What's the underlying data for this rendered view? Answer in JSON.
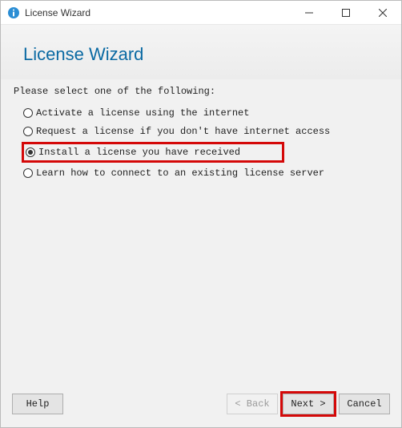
{
  "window": {
    "title": "License Wizard"
  },
  "header": {
    "title": "License Wizard"
  },
  "prompt": "Please select one of the following:",
  "options": [
    {
      "label": "Activate a license using the internet",
      "checked": false,
      "highlighted": false
    },
    {
      "label": "Request a license if you don't have internet access",
      "checked": false,
      "highlighted": false
    },
    {
      "label": "Install a license you have received",
      "checked": true,
      "highlighted": true
    },
    {
      "label": "Learn how to connect to an existing license server",
      "checked": false,
      "highlighted": false
    }
  ],
  "footer": {
    "help": "Help",
    "back": "< Back",
    "next": "Next >",
    "cancel": "Cancel"
  },
  "colors": {
    "accent": "#0b6aa3",
    "highlight": "#d40808"
  }
}
